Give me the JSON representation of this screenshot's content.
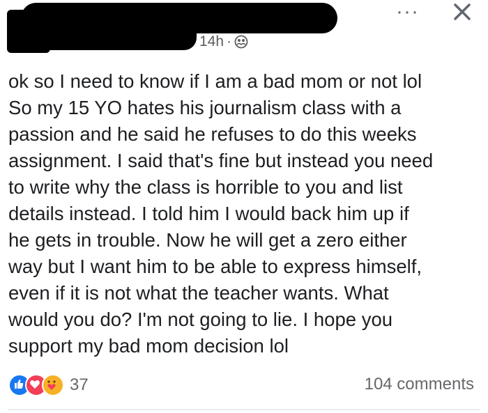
{
  "post_meta": {
    "time": "14h",
    "separator": "·",
    "audience_icon": "friends-icon"
  },
  "header_actions": {
    "more_label": "···",
    "close_icon": "close-icon"
  },
  "post": {
    "text": "ok so I need to know if I am a bad mom or not lol\nSo my 15 YO hates his journalism class with a\npassion and he said he refuses to do this weeks\nassignment. I said that's fine but instead you need\nto write why the class is horrible to you and list\ndetails instead. I told him I would back him up if\nhe gets in trouble. Now he will get a zero either\nway but I want him to be able to express himself,\neven if it is not what the teacher wants. What\nwould you do? I'm not going to lie. I hope you\nsupport my bad mom decision lol"
  },
  "footer": {
    "reaction_icons": [
      "like-icon",
      "love-icon",
      "care-icon"
    ],
    "reaction_count": "37",
    "comments": "104 comments"
  },
  "colors": {
    "text": "#1c1e21",
    "secondary": "#65676b",
    "like": "#1877f2",
    "love": "#f33e58",
    "care": "#f7b125"
  }
}
